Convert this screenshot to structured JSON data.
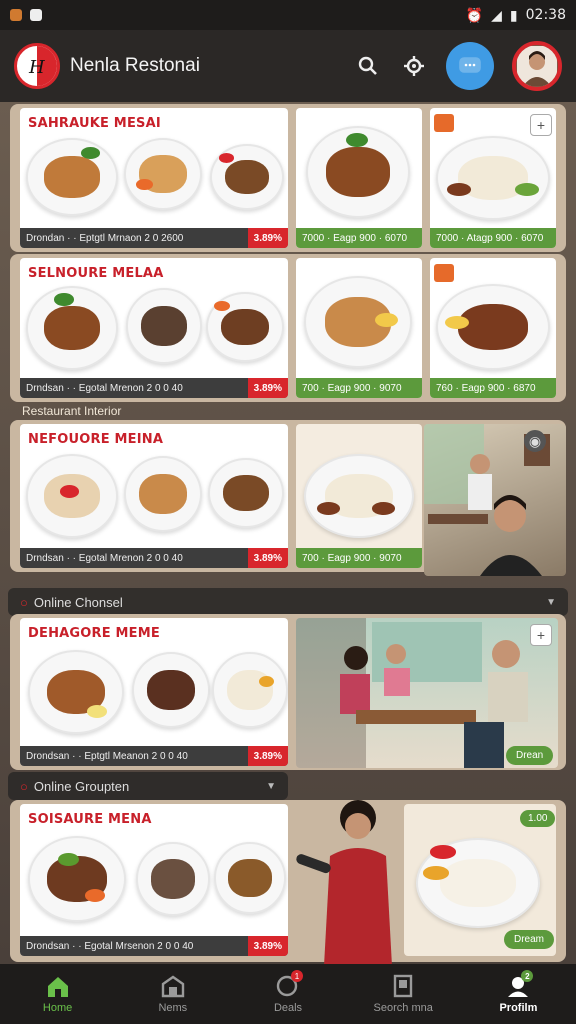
{
  "status_bar": {
    "time": "02:38"
  },
  "header": {
    "title": "Nenla Restonai",
    "logo_text": "H"
  },
  "panel1": {
    "card_main": {
      "title": "SAHRAUKE MESAI",
      "footer": "Drondan · · Eptgtl Mrnaon 2 0 2600",
      "badge": "3.89%"
    },
    "card_mid": {
      "footer": "7000 · Eagp 900 · 6070"
    },
    "card_right": {
      "footer": "7000 · Atagp 900 · 6070"
    }
  },
  "panel2": {
    "card_main": {
      "title": "SELNOURE MELAA",
      "footer": "Drndsan · · Egotal Mrenon 2 0 0 40",
      "badge": "3.89%"
    },
    "card_mid": {
      "footer": "700 · Eagp 900 · 9070"
    },
    "card_right": {
      "footer": "760 · Eagp 900 · 6870"
    },
    "overlay": "Restaurant Interior"
  },
  "panel3": {
    "card_main": {
      "title": "NEFOUORE MEINA",
      "footer": "Drndsan · · Egotal Mrenon 2 0 0 40",
      "badge": "3.89%"
    },
    "card_mid": {
      "footer": "700 · Eagp 900 · 9070"
    }
  },
  "section1": {
    "label": "Online Chonsel"
  },
  "panel4": {
    "card_main": {
      "title": "DEHAGORE MEME",
      "footer": "Drondsan · · Eptgtl Meanon 2 0 0 40",
      "badge": "3.89%"
    },
    "photo_pill": "Drean"
  },
  "section2": {
    "label": "Online Groupten"
  },
  "panel5": {
    "card_main": {
      "title": "SOISAURE MENA",
      "footer": "Drondsan · · Egotal Mrsenon 2 0 0 40",
      "badge": "3.89%"
    },
    "photo_pill_top": "1.00",
    "photo_pill_bottom": "Dream"
  },
  "nav": {
    "items": [
      {
        "label": "Home",
        "icon": "home-icon"
      },
      {
        "label": "Nems",
        "icon": "store-icon"
      },
      {
        "label": "Deals",
        "icon": "chat-icon",
        "badge": "1"
      },
      {
        "label": "Seorch mna",
        "icon": "list-icon"
      },
      {
        "label": "Profilm",
        "icon": "profile-icon",
        "badge": "2"
      }
    ]
  },
  "colors": {
    "accent_red": "#d8262c",
    "accent_green": "#5c9a3c",
    "accent_blue": "#3f9be4"
  }
}
